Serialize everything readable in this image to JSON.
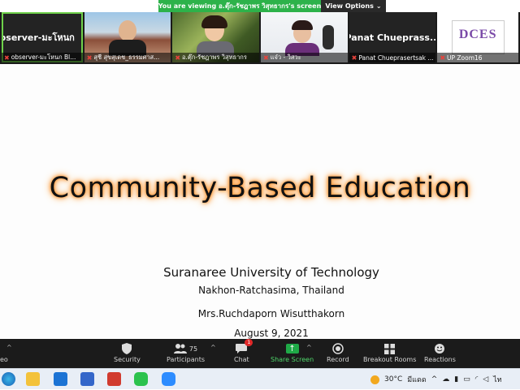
{
  "banner": {
    "viewing_text": "You are viewing อ.ตุ๊ก-รัชฎาพร วิสุทธากร's screen",
    "view_options_label": "View Options"
  },
  "participants": [
    {
      "display_name": "observer-มะโหนก",
      "caption": "observer-มะโหนก Bl...",
      "video": false,
      "active": true
    },
    {
      "display_name": "",
      "caption": "สุชี สุขสุเดช_ธรรมศาส...",
      "video": true
    },
    {
      "display_name": "",
      "caption": "อ.ตุ๊ก-รัชฎาพร วิสุทธากร",
      "video": true
    },
    {
      "display_name": "",
      "caption": "แจ๋ว - วิสวะ",
      "video": true
    },
    {
      "display_name": "Panat Chueprass...",
      "caption": "Panat Chueprasertsak ...",
      "video": false
    },
    {
      "display_name": "",
      "caption": "UP Zoom16",
      "video": false,
      "logo_text": "DCES"
    }
  ],
  "slide": {
    "title": "Community-Based Education",
    "university": "Suranaree University of Technology",
    "location": "Nakhon-Ratchasima, Thailand",
    "presenter": "Mrs.Ruchdaporn Wisutthakorn",
    "date": "August 9, 2021"
  },
  "toolbar": {
    "video_label": "eo",
    "security_label": "Security",
    "participants_label": "Participants",
    "participants_count": "75",
    "chat_label": "Chat",
    "chat_badge": "1",
    "share_label": "Share Screen",
    "record_label": "Record",
    "breakout_label": "Breakout Rooms",
    "reactions_label": "Reactions"
  },
  "taskbar": {
    "weather": "30°C",
    "weather_desc": "มีแดด",
    "lang": "ไท"
  },
  "icons": [
    "shield-icon",
    "people-icon",
    "chat-icon",
    "share-arrow-icon",
    "record-icon",
    "grid-icon",
    "smile-icon",
    "caret-icon",
    "mic-off-icon"
  ]
}
